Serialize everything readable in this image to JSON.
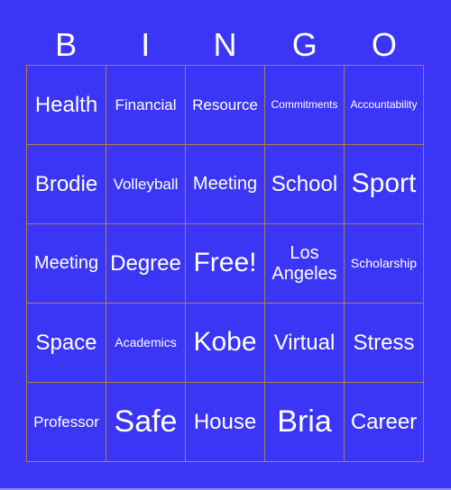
{
  "header": [
    "B",
    "I",
    "N",
    "G",
    "O"
  ],
  "cells": [
    [
      "Health",
      "Financial",
      "Resource",
      "Commitments",
      "Accountability"
    ],
    [
      "Brodie",
      "Volleyball",
      "Meeting",
      "School",
      "Sport"
    ],
    [
      "Meeting",
      "Degree",
      "Free!",
      "Los Angeles",
      "Scholarship"
    ],
    [
      "Space",
      "Academics",
      "Kobe",
      "Virtual",
      "Stress"
    ],
    [
      "Professor",
      "Safe",
      "House",
      "Bria",
      "Career"
    ]
  ],
  "colors": {
    "background": "#3b36f5",
    "grid_border": "#b07d4a",
    "text": "#ffffff"
  }
}
